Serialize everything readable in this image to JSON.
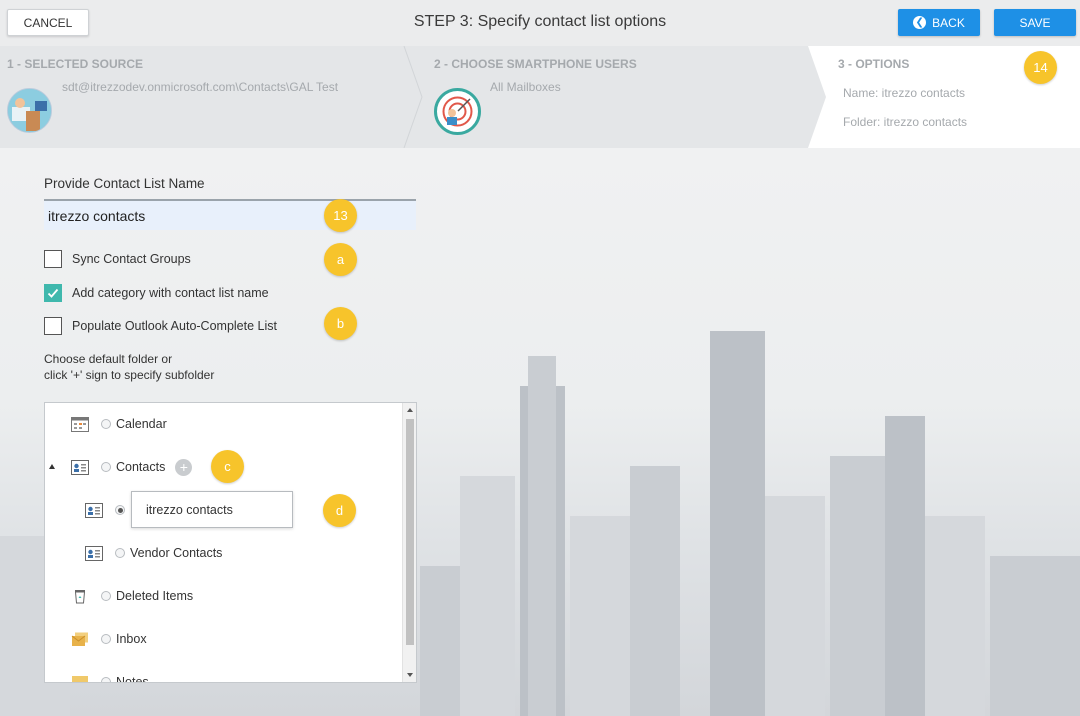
{
  "toolbar": {
    "cancel_label": "CANCEL",
    "title": "STEP 3: Specify contact list options",
    "back_label": "BACK",
    "save_label": "SAVE"
  },
  "steps": [
    {
      "title": "1 - SELECTED SOURCE",
      "detail": "sdt@itrezzodev.onmicrosoft.com\\Contacts\\GAL Test"
    },
    {
      "title": "2 - CHOOSE SMARTPHONE USERS",
      "detail": "All Mailboxes"
    },
    {
      "title": "3 - OPTIONS",
      "name_line": "Name: itrezzo contacts",
      "folder_line": "Folder: itrezzo contacts"
    }
  ],
  "badges": {
    "save": "14",
    "name": "13",
    "sync": "a",
    "populate": "b",
    "plus": "c",
    "rename": "d"
  },
  "form": {
    "name_label": "Provide Contact List Name",
    "name_value": "itrezzo contacts",
    "sync_groups": {
      "label": "Sync Contact Groups",
      "checked": false
    },
    "add_category": {
      "label": "Add category with contact list name",
      "checked": true
    },
    "populate": {
      "label": "Populate Outlook Auto-Complete List",
      "checked": false
    },
    "help_line1": "Choose default folder or",
    "help_line2": "click '+' sign to specify subfolder"
  },
  "tree": {
    "items": [
      {
        "label": "Calendar",
        "icon": "calendar-icon"
      },
      {
        "label": "Contacts",
        "icon": "contacts-icon"
      },
      {
        "label": "itrezzo contacts",
        "icon": "contacts-icon",
        "selected": true
      },
      {
        "label": "Vendor Contacts",
        "icon": "contacts-icon"
      },
      {
        "label": "Deleted Items",
        "icon": "trash-icon"
      },
      {
        "label": "Inbox",
        "icon": "inbox-icon"
      },
      {
        "label": "Notes",
        "icon": "notes-icon"
      }
    ]
  },
  "colors": {
    "accent": "#1e90e6",
    "check": "#3fb8ad",
    "badge": "#f7c42b"
  }
}
